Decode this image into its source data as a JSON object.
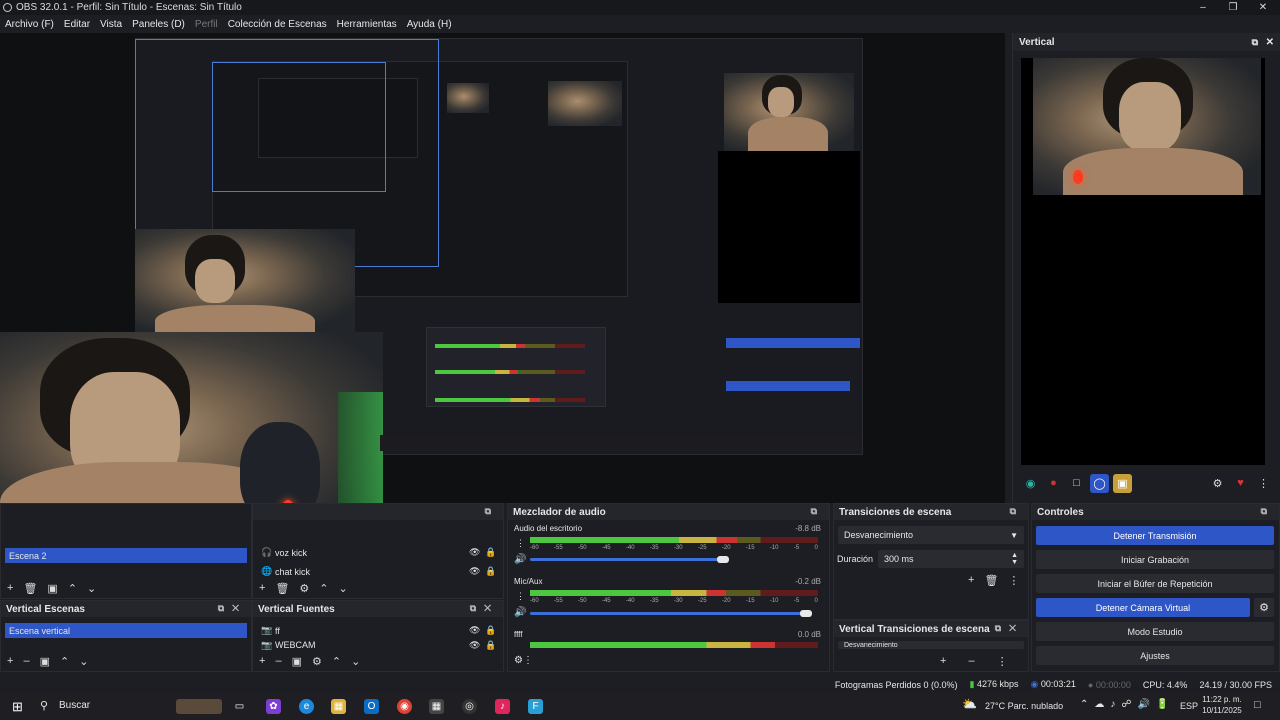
{
  "window": {
    "title": "OBS 32.0.1 - Perfil: Sin Título - Escenas: Sin Título"
  },
  "menu": [
    "Archivo (F)",
    "Editar",
    "Vista",
    "Paneles (D)",
    "Perfil",
    "Colección de Escenas",
    "Herramientas",
    "Ayuda (H)"
  ],
  "vertical_panel": {
    "title": "Vertical"
  },
  "scenes_panel": {
    "selected_scene": "Escena 2"
  },
  "sources_panel": {
    "items": [
      "voz kick",
      "chat kick"
    ]
  },
  "vertical_scenes": {
    "title": "Vertical Escenas",
    "items": [
      "Escena vertical"
    ]
  },
  "vertical_sources": {
    "title": "Vertical Fuentes",
    "items": [
      "ff",
      "WEBCAM"
    ]
  },
  "audio_mixer": {
    "title": "Mezclador de audio",
    "channels": [
      {
        "name": "Audio del escritorio",
        "db": "-8.8 dB",
        "level": 0.72,
        "volume": 0.67
      },
      {
        "name": "Mic/Aux",
        "db": "-0.2 dB",
        "level": 0.68,
        "volume": 0.96
      },
      {
        "name": "ffff",
        "db": "0.0 dB",
        "level": 0.85,
        "volume": 0.9
      }
    ],
    "scale": [
      "-60",
      "-55",
      "-50",
      "-45",
      "-40",
      "-35",
      "-30",
      "-25",
      "-20",
      "-15",
      "-10",
      "-5",
      "0"
    ]
  },
  "transitions": {
    "title": "Transiciones de escena",
    "selected": "Desvanecimiento",
    "duration_label": "Duración",
    "duration_value": "300 ms"
  },
  "vertical_transitions": {
    "title": "Vertical Transiciones de escena",
    "selected": "Desvanecimiento"
  },
  "controls": {
    "title": "Controles",
    "buttons": [
      {
        "label": "Detener Transmisión",
        "active": true
      },
      {
        "label": "Iniciar Grabación",
        "active": false
      },
      {
        "label": "Iniciar el Búfer de Repetición",
        "active": false
      },
      {
        "label": "Detener Cámara Virtual",
        "active": true
      },
      {
        "label": "Modo Estudio",
        "active": false
      },
      {
        "label": "Ajustes",
        "active": false
      }
    ]
  },
  "status": {
    "dropped_frames": "Fotogramas Perdidos 0 (0.0%)",
    "bitrate": "4276 kbps",
    "stream_time": "00:03:21",
    "rec_time": "00:00:00",
    "cpu": "CPU: 4.4%",
    "fps": "24.19 / 30.00 FPS"
  },
  "taskbar": {
    "search": "Buscar",
    "weather": "27°C  Parc. nublado",
    "lang": "ESP",
    "time": "11:22 p. m.",
    "date": "10/11/2025"
  },
  "colors": {
    "accent": "#2f56c7",
    "bg": "#1d1e23",
    "meter_green": "#4cc73f"
  }
}
